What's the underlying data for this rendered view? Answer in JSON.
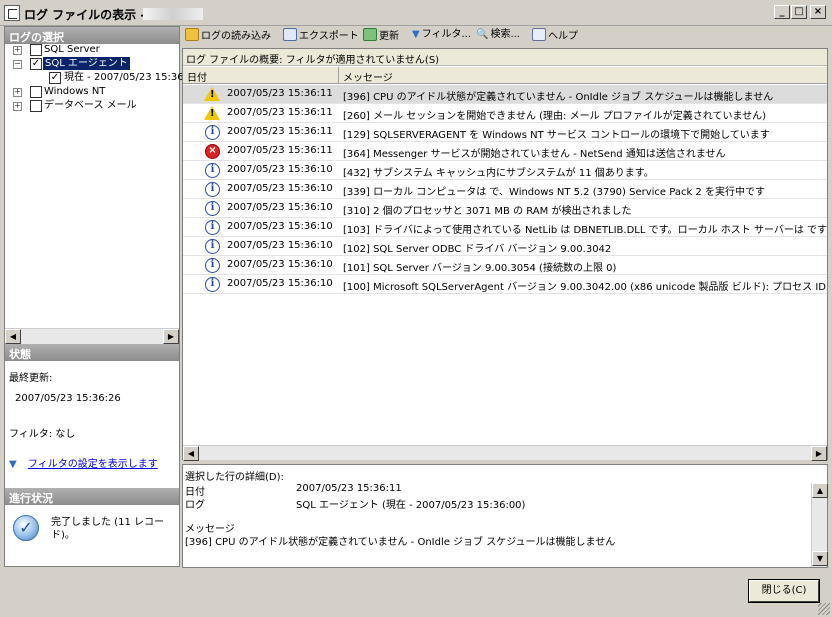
{
  "window": {
    "title": "ログ ファイルの表示 -",
    "controls": {
      "minimize": "_",
      "maximize": "□",
      "close": "×"
    }
  },
  "left": {
    "log_select_header": "ログの選択",
    "tree": [
      {
        "label": "SQL Server",
        "expand": "+",
        "checked": "",
        "indent": 0
      },
      {
        "label": "SQL エージェント",
        "expand": "−",
        "checked": "✓",
        "indent": 0,
        "selected": true
      },
      {
        "label": "現在 - 2007/05/23 15:36",
        "expand": "",
        "checked": "✓",
        "indent": 1
      },
      {
        "label": "Windows NT",
        "expand": "+",
        "checked": "",
        "indent": 0
      },
      {
        "label": "データベース メール",
        "expand": "+",
        "checked": "",
        "indent": 0
      }
    ],
    "status_header": "状態",
    "last_update_label": "最終更新:",
    "last_update_value": "2007/05/23 15:36:26",
    "filter_label": "フィルタ: なし",
    "filter_link": "フィルタの設定を表示します",
    "progress_header": "進行状況",
    "progress_text_1": "完了しました (11 レコー",
    "progress_text_2": "ド)。"
  },
  "toolbar": {
    "load_log": "ログの読み込み",
    "export": "エクスポート",
    "refresh": "更新",
    "filter": "フィルタ...",
    "search": "検索...",
    "help": "ヘルプ"
  },
  "grid": {
    "caption": "ログ ファイルの概要: フィルタが適用されていません(S)",
    "col_date": "日付",
    "col_message": "メッセージ",
    "rows": [
      {
        "type": "warning",
        "date": "2007/05/23 15:36:11",
        "message": "[396] CPU のアイドル状態が定義されていません - OnIdle ジョブ スケジュールは機能しません"
      },
      {
        "type": "warning",
        "date": "2007/05/23 15:36:11",
        "message": "[260] メール セッションを開始できません (理由: メール プロファイルが定義されていません)"
      },
      {
        "type": "info",
        "date": "2007/05/23 15:36:11",
        "message": "[129] SQLSERVERAGENT を Windows NT サービス コントロールの環境下で開始しています"
      },
      {
        "type": "error",
        "date": "2007/05/23 15:36:11",
        "message": "[364] Messenger サービスが開始されていません - NetSend 通知は送信されません"
      },
      {
        "type": "info",
        "date": "2007/05/23 15:36:10",
        "message": "[432] サブシステム キャッシュ内にサブシステムが 11 個あります。"
      },
      {
        "type": "info",
        "date": "2007/05/23 15:36:10",
        "message": "[339] ローカル コンピュータは                で、Windows NT 5.2 (3790) Service Pack 2 を実行中です"
      },
      {
        "type": "info",
        "date": "2007/05/23 15:36:10",
        "message": "[310] 2 個のプロセッサと 3071 MB の RAM が検出されました"
      },
      {
        "type": "info",
        "date": "2007/05/23 15:36:10",
        "message": "[103] ドライバによって使用されている NetLib は DBNETLIB.DLL です。ローカル ホスト サーバーは  です"
      },
      {
        "type": "info",
        "date": "2007/05/23 15:36:10",
        "message": "[102] SQL Server ODBC ドライバ バージョン 9.00.3042"
      },
      {
        "type": "info",
        "date": "2007/05/23 15:36:10",
        "message": "[101] SQL Server                  バージョン 9.00.3054 (接続数の上限 0)"
      },
      {
        "type": "info",
        "date": "2007/05/23 15:36:10",
        "message": "[100] Microsoft SQLServerAgent バージョン 9.00.3042.00 (x86 unicode 製品版 ビルド): プロセス ID"
      }
    ]
  },
  "details": {
    "header": "選択した行の詳細(D):",
    "date_label": "日付",
    "date_value": "2007/05/23 15:36:11",
    "log_label": "ログ",
    "log_value": "SQL エージェント (現在 - 2007/05/23 15:36:00)",
    "message_label": "メッセージ",
    "message_value": "[396] CPU のアイドル状態が定義されていません - OnIdle ジョブ スケジュールは機能しません"
  },
  "footer": {
    "close_button": "閉じる(C)"
  },
  "icons": {
    "warning": "warning-icon",
    "info": "info-icon",
    "error": "error-icon"
  },
  "colors": {
    "selection": "#0a246a",
    "link": "#0000ee",
    "panel_header": "#8c8c8c"
  }
}
